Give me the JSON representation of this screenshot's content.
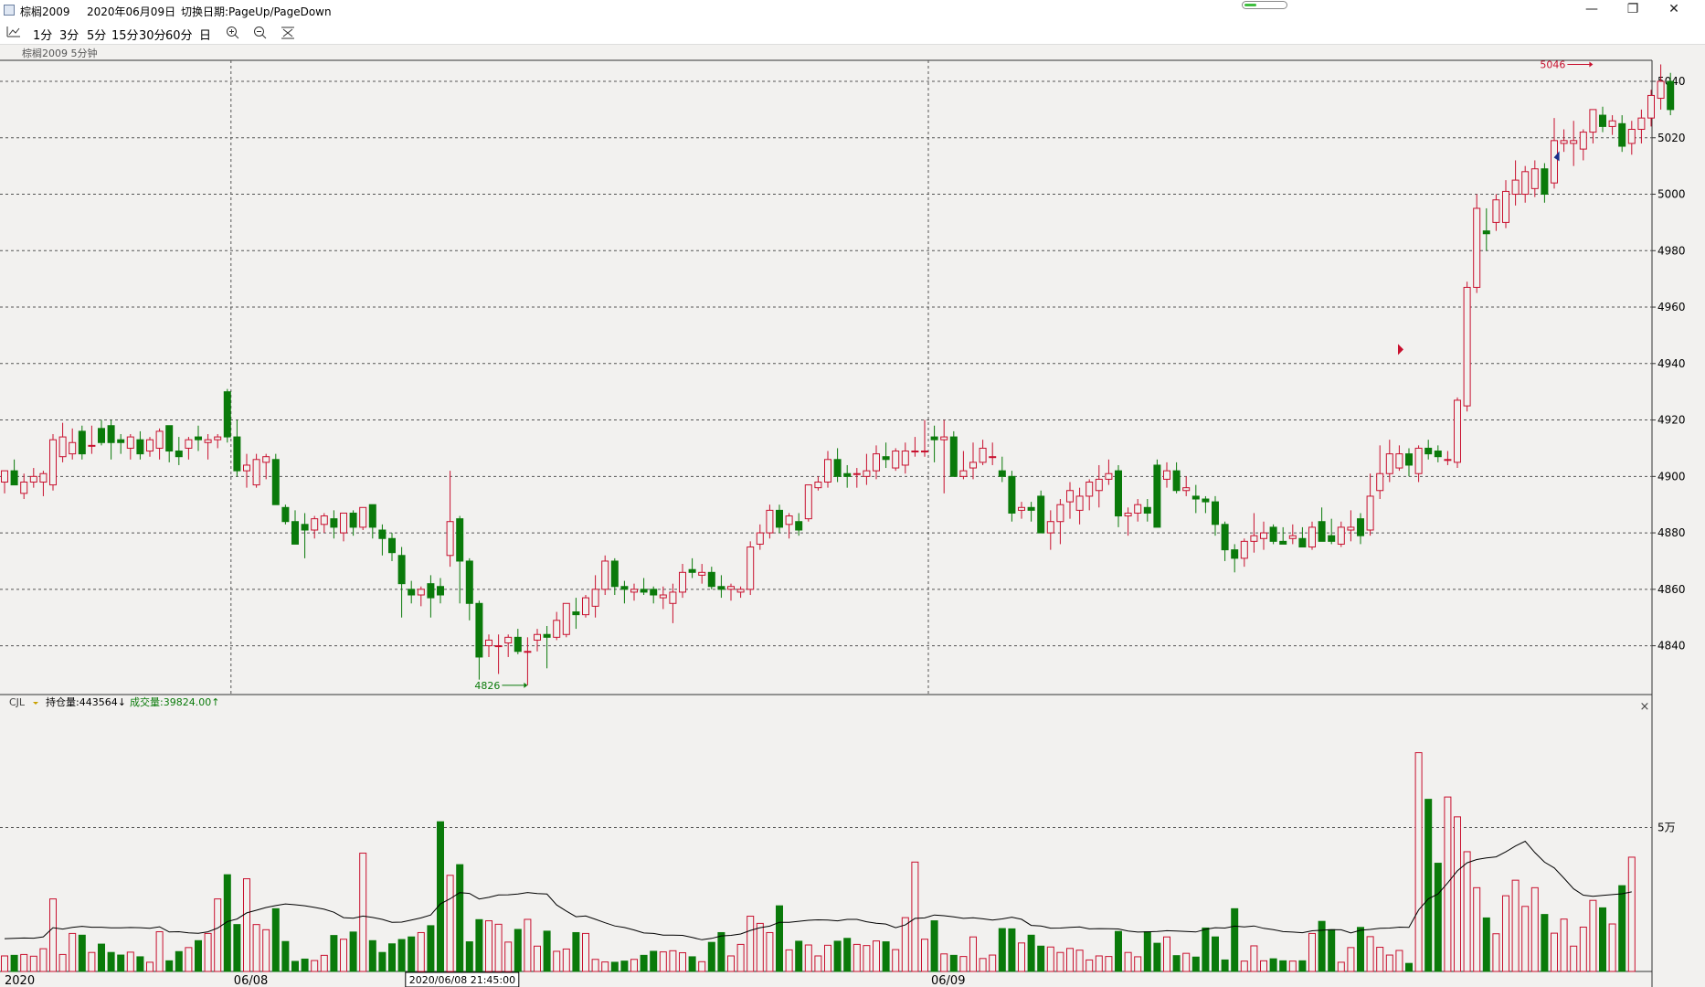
{
  "window": {
    "title": "棕榈2009",
    "date": "2020年06月09日",
    "hint": "切换日期:PageUp/PageDown",
    "progress_fraction": 0.3
  },
  "toolbar": {
    "chart_icon": "line-chart-icon",
    "periods": [
      "1分",
      "3分",
      "5分",
      "15分",
      "30分",
      "60分",
      "日"
    ],
    "zoom_in_icon": "zoom-in-icon",
    "zoom_out_icon": "zoom-out-icon",
    "reset_icon": "reset-zoom-icon"
  },
  "subtitle": "棕榈2009    5分钟",
  "indicator": {
    "name": "CJL",
    "oi_label": "持仓量:443564↓",
    "vol_label": "成交量:39824.00↑"
  },
  "colors": {
    "up": "#c8102e",
    "down": "#0a7a0a",
    "grid": "#555555",
    "bg": "#f2f1ef"
  },
  "chart_data": [
    {
      "type": "candlestick",
      "y_ticks": [
        4840,
        4860,
        4880,
        4900,
        4920,
        4940,
        4960,
        4980,
        5000,
        5020,
        5040
      ],
      "ylim": [
        4825,
        5048
      ],
      "x_labels": [
        {
          "index": 0,
          "label": "2020"
        },
        {
          "index": 23,
          "label": "06/08"
        },
        {
          "index": 95,
          "label": "06/09"
        }
      ],
      "crosshair_time": "2020/06/08 21:45:00",
      "high_marker": {
        "label": "5046",
        "value": 5046,
        "index": 164
      },
      "low_marker": {
        "label": "4826",
        "value": 4826,
        "index": 54
      },
      "signals": [
        {
          "index": 145,
          "value": 4945,
          "kind": "buy",
          "color": "#c8102e"
        },
        {
          "index": 161,
          "value": 5013,
          "kind": "sell",
          "color": "#1a2f8a"
        }
      ],
      "ohlc": [
        [
          4898,
          4902,
          4894,
          4902
        ],
        [
          4902,
          4906,
          4898,
          4897
        ],
        [
          4894,
          4901,
          4892,
          4898
        ],
        [
          4898,
          4903,
          4896,
          4900
        ],
        [
          4898,
          4902,
          4893,
          4901
        ],
        [
          4897,
          4915,
          4895,
          4913
        ],
        [
          4907,
          4919,
          4905,
          4914
        ],
        [
          4908,
          4917,
          4906,
          4912
        ],
        [
          4916,
          4918,
          4906,
          4908
        ],
        [
          4911,
          4918,
          4908,
          4911
        ],
        [
          4917,
          4920,
          4911,
          4912
        ],
        [
          4918,
          4920,
          4906,
          4912
        ],
        [
          4913,
          4915,
          4908,
          4912
        ],
        [
          4910,
          4915,
          4906,
          4914
        ],
        [
          4913,
          4916,
          4906,
          4908
        ],
        [
          4909,
          4914,
          4907,
          4913
        ],
        [
          4910,
          4917,
          4906,
          4916
        ],
        [
          4918,
          4918,
          4905,
          4909
        ],
        [
          4909,
          4914,
          4904,
          4907
        ],
        [
          4910,
          4914,
          4906,
          4913
        ],
        [
          4914,
          4918,
          4909,
          4913
        ],
        [
          4912,
          4915,
          4906,
          4913
        ],
        [
          4913,
          4915,
          4910,
          4914
        ],
        [
          4930,
          4931,
          4912,
          4914
        ],
        [
          4914,
          4920,
          4900,
          4902
        ],
        [
          4902,
          4908,
          4896,
          4904
        ],
        [
          4897,
          4908,
          4896,
          4906
        ],
        [
          4905,
          4908,
          4899,
          4907
        ],
        [
          4906,
          4908,
          4895,
          4890
        ],
        [
          4889,
          4890,
          4883,
          4884
        ],
        [
          4884,
          4888,
          4877,
          4876
        ],
        [
          4883,
          4887,
          4871,
          4881
        ],
        [
          4881,
          4886,
          4878,
          4885
        ],
        [
          4883,
          4887,
          4880,
          4886
        ],
        [
          4885,
          4888,
          4878,
          4882
        ],
        [
          4880,
          4883,
          4877,
          4887
        ],
        [
          4887,
          4888,
          4879,
          4882
        ],
        [
          4882,
          4889,
          4881,
          4889
        ],
        [
          4890,
          4890,
          4878,
          4882
        ],
        [
          4881,
          4883,
          4872,
          4878
        ],
        [
          4878,
          4880,
          4870,
          4873
        ],
        [
          4872,
          4875,
          4850,
          4862
        ],
        [
          4860,
          4863,
          4855,
          4858
        ],
        [
          4858,
          4861,
          4854,
          4860
        ],
        [
          4862,
          4865,
          4850,
          4857
        ],
        [
          4861,
          4864,
          4855,
          4858
        ],
        [
          4872,
          4902,
          4868,
          4884
        ],
        [
          4885,
          4886,
          4855,
          4870
        ],
        [
          4870,
          4871,
          4849,
          4855
        ],
        [
          4855,
          4856,
          4828,
          4836
        ],
        [
          4840,
          4844,
          4836,
          4842
        ],
        [
          4840,
          4844,
          4830,
          4840
        ],
        [
          4841,
          4844,
          4836,
          4843
        ],
        [
          4843,
          4846,
          4837,
          4838
        ],
        [
          4838,
          4843,
          4826,
          4838
        ],
        [
          4842,
          4846,
          4838,
          4844
        ],
        [
          4844,
          4847,
          4832,
          4843
        ],
        [
          4843,
          4852,
          4842,
          4849
        ],
        [
          4844,
          4855,
          4843,
          4855
        ],
        [
          4852,
          4857,
          4846,
          4851
        ],
        [
          4851,
          4858,
          4850,
          4857
        ],
        [
          4854,
          4865,
          4850,
          4860
        ],
        [
          4860,
          4872,
          4858,
          4870
        ],
        [
          4870,
          4871,
          4858,
          4861
        ],
        [
          4861,
          4863,
          4855,
          4860
        ],
        [
          4859,
          4862,
          4856,
          4860
        ],
        [
          4860,
          4864,
          4858,
          4859
        ],
        [
          4860,
          4861,
          4855,
          4858
        ],
        [
          4857,
          4861,
          4853,
          4858
        ],
        [
          4855,
          4862,
          4848,
          4859
        ],
        [
          4859,
          4869,
          4857,
          4866
        ],
        [
          4867,
          4871,
          4864,
          4866
        ],
        [
          4865,
          4869,
          4862,
          4866
        ],
        [
          4866,
          4868,
          4860,
          4861
        ],
        [
          4861,
          4865,
          4857,
          4860
        ],
        [
          4860,
          4862,
          4856,
          4861
        ],
        [
          4859,
          4861,
          4857,
          4860
        ],
        [
          4860,
          4877,
          4858,
          4875
        ],
        [
          4876,
          4883,
          4874,
          4880
        ],
        [
          4880,
          4890,
          4878,
          4888
        ],
        [
          4888,
          4890,
          4880,
          4882
        ],
        [
          4883,
          4887,
          4878,
          4886
        ],
        [
          4884,
          4887,
          4879,
          4881
        ],
        [
          4885,
          4897,
          4884,
          4897
        ],
        [
          4896,
          4900,
          4895,
          4898
        ],
        [
          4898,
          4909,
          4896,
          4906
        ],
        [
          4906,
          4910,
          4898,
          4900
        ],
        [
          4901,
          4904,
          4896,
          4900
        ],
        [
          4901,
          4903,
          4896,
          4901
        ],
        [
          4900,
          4908,
          4897,
          4902
        ],
        [
          4902,
          4911,
          4899,
          4908
        ],
        [
          4907,
          4912,
          4903,
          4906
        ],
        [
          4903,
          4910,
          4902,
          4909
        ],
        [
          4904,
          4912,
          4901,
          4909
        ],
        [
          4909,
          4914,
          4907,
          4909
        ],
        [
          4909,
          4920,
          4907,
          4909
        ],
        [
          4914,
          4918,
          4905,
          4913
        ],
        [
          4913,
          4920,
          4894,
          4914
        ],
        [
          4914,
          4916,
          4900,
          4900
        ],
        [
          4900,
          4909,
          4899,
          4902
        ],
        [
          4903,
          4912,
          4899,
          4905
        ],
        [
          4905,
          4913,
          4904,
          4910
        ],
        [
          4907,
          4912,
          4904,
          4907
        ],
        [
          4902,
          4907,
          4898,
          4900
        ],
        [
          4900,
          4902,
          4884,
          4887
        ],
        [
          4888,
          4891,
          4885,
          4889
        ],
        [
          4889,
          4891,
          4884,
          4888
        ],
        [
          4893,
          4895,
          4882,
          4880
        ],
        [
          4880,
          4888,
          4874,
          4884
        ],
        [
          4884,
          4892,
          4876,
          4890
        ],
        [
          4891,
          4898,
          4885,
          4895
        ],
        [
          4888,
          4896,
          4883,
          4893
        ],
        [
          4893,
          4899,
          4888,
          4898
        ],
        [
          4895,
          4904,
          4889,
          4899
        ],
        [
          4899,
          4906,
          4897,
          4901
        ],
        [
          4902,
          4904,
          4882,
          4886
        ],
        [
          4886,
          4889,
          4879,
          4887
        ],
        [
          4887,
          4892,
          4884,
          4890
        ],
        [
          4889,
          4892,
          4884,
          4887
        ],
        [
          4904,
          4906,
          4886,
          4882
        ],
        [
          4899,
          4905,
          4896,
          4902
        ],
        [
          4902,
          4905,
          4894,
          4895
        ],
        [
          4895,
          4900,
          4893,
          4896
        ],
        [
          4893,
          4897,
          4887,
          4892
        ],
        [
          4892,
          4893,
          4887,
          4891
        ],
        [
          4891,
          4893,
          4879,
          4883
        ],
        [
          4883,
          4884,
          4870,
          4874
        ],
        [
          4874,
          4876,
          4866,
          4871
        ],
        [
          4871,
          4878,
          4868,
          4877
        ],
        [
          4877,
          4887,
          4873,
          4879
        ],
        [
          4878,
          4884,
          4874,
          4880
        ],
        [
          4882,
          4883,
          4876,
          4877
        ],
        [
          4877,
          4882,
          4876,
          4876
        ],
        [
          4878,
          4883,
          4876,
          4879
        ],
        [
          4878,
          4882,
          4875,
          4875
        ],
        [
          4875,
          4884,
          4874,
          4882
        ],
        [
          4884,
          4889,
          4879,
          4877
        ],
        [
          4879,
          4885,
          4876,
          4877
        ],
        [
          4876,
          4884,
          4875,
          4882
        ],
        [
          4881,
          4888,
          4877,
          4882
        ],
        [
          4885,
          4887,
          4876,
          4879
        ],
        [
          4881,
          4901,
          4879,
          4893
        ],
        [
          4895,
          4911,
          4892,
          4901
        ],
        [
          4901,
          4913,
          4898,
          4908
        ],
        [
          4903,
          4911,
          4902,
          4908
        ],
        [
          4908,
          4910,
          4900,
          4904
        ],
        [
          4901,
          4911,
          4898,
          4910
        ],
        [
          4910,
          4913,
          4906,
          4908
        ],
        [
          4909,
          4911,
          4905,
          4907
        ],
        [
          4906,
          4909,
          4904,
          4906
        ],
        [
          4905,
          4928,
          4903,
          4927
        ],
        [
          4925,
          4969,
          4923,
          4967
        ],
        [
          4967,
          5000,
          4965,
          4995
        ],
        [
          4987,
          4995,
          4980,
          4986
        ],
        [
          4990,
          5000,
          4987,
          4998
        ],
        [
          4990,
          5005,
          4988,
          5001
        ],
        [
          5000,
          5012,
          4996,
          5005
        ],
        [
          5000,
          5010,
          4997,
          5008
        ],
        [
          5002,
          5012,
          4999,
          5009
        ],
        [
          5009,
          5011,
          4997,
          5000
        ],
        [
          5004,
          5027,
          5002,
          5019
        ],
        [
          5018,
          5023,
          5015,
          5019
        ],
        [
          5018,
          5026,
          5010,
          5019
        ],
        [
          5016,
          5023,
          5012,
          5022
        ],
        [
          5022,
          5030,
          5018,
          5030
        ],
        [
          5028,
          5031,
          5022,
          5024
        ],
        [
          5024,
          5028,
          5021,
          5026
        ],
        [
          5025,
          5028,
          5015,
          5017
        ],
        [
          5018,
          5026,
          5014,
          5023
        ],
        [
          5023,
          5030,
          5018,
          5027
        ],
        [
          5027,
          5037,
          5024,
          5035
        ],
        [
          5034,
          5046,
          5030,
          5040
        ],
        [
          5040,
          5043,
          5028,
          5030
        ]
      ]
    },
    {
      "type": "bar",
      "title": "CJL",
      "y_ticks_labels": [
        {
          "value": 50000,
          "label": "5万"
        }
      ],
      "ylim": [
        0,
        78000
      ],
      "volume": [
        5400,
        5600,
        5900,
        5300,
        7900,
        25200,
        5900,
        13200,
        12600,
        6600,
        9500,
        6600,
        5700,
        6700,
        5100,
        3200,
        13800,
        3700,
        6900,
        8300,
        10700,
        13200,
        25200,
        33600,
        16300,
        32200,
        16300,
        14500,
        21800,
        10400,
        3500,
        4300,
        3800,
        5600,
        12500,
        11200,
        13700,
        41100,
        10700,
        6600,
        9600,
        11100,
        12000,
        13500,
        15900,
        52000,
        33400,
        37100,
        10300,
        18000,
        17600,
        16400,
        10200,
        14600,
        18100,
        8800,
        14000,
        7000,
        7800,
        13500,
        13200,
        4200,
        3300,
        3200,
        3600,
        4200,
        5600,
        7000,
        6800,
        7200,
        6500,
        5100,
        3400,
        10100,
        13500,
        5400,
        9400,
        19200,
        16700,
        13500,
        22800,
        7500,
        10500,
        9200,
        5400,
        9100,
        10500,
        11500,
        9400,
        9000,
        10600,
        10300,
        7600,
        18700,
        38000,
        11200,
        17600,
        6100,
        5600,
        5200,
        12000,
        4500,
        5700,
        14900,
        14800,
        9900,
        12600,
        8800,
        8500,
        6600,
        8000,
        7400,
        4000,
        5400,
        5200,
        13900,
        6600,
        5100,
        13800,
        9800,
        12000,
        5500,
        6300,
        5000,
        15100,
        12000,
        4000,
        21800,
        3600,
        8900,
        3700,
        4400,
        3700,
        3600,
        3700,
        13200,
        17400,
        14500,
        3200,
        8300,
        15300,
        12100,
        8400,
        5700,
        7300,
        2800,
        76000,
        59800,
        37600,
        60600,
        53700,
        41600,
        29100,
        18600,
        13100,
        26300,
        31700,
        22600,
        29100,
        19800,
        13300,
        18200,
        8800,
        15400,
        24700,
        22100,
        16500,
        29800,
        39700
      ]
    }
  ]
}
